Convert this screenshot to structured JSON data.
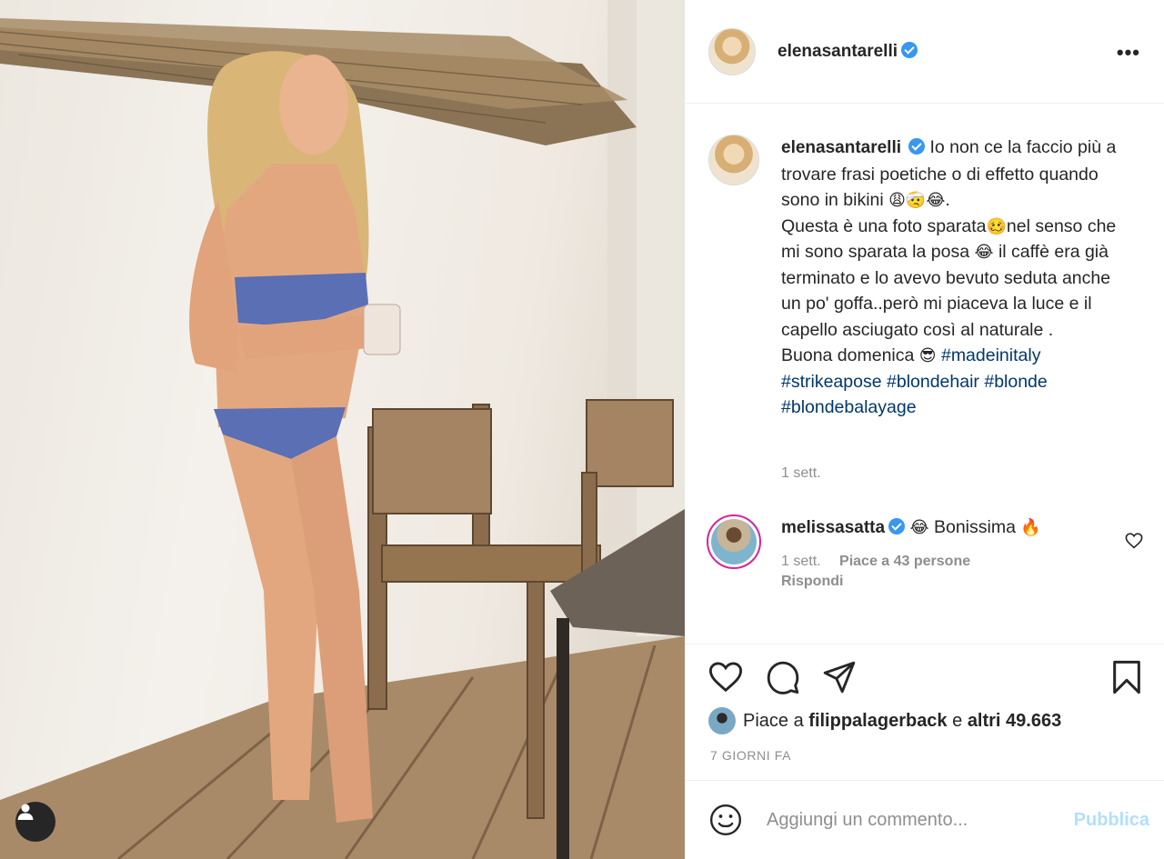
{
  "post": {
    "username": "elenasantarelli",
    "verified": true,
    "more_icon": "more-horizontal-icon",
    "caption": {
      "line1": "Io non ce la faccio più a trovare frasi poetiche o di effetto quando sono in bikini",
      "emojis1": "😩🤕😂",
      "line2": "Questa è una foto sparata",
      "emoji2": "🥴",
      "line3": "nel senso che mi sono sparata la posa",
      "emoji3": "😂",
      "line4": "il caffè era già terminato e lo avevo bevuto seduta anche un po' goffa..però mi piaceva la luce e il capello asciugato così al naturale .",
      "line5": "Buona domenica",
      "emoji5": "😎",
      "hashtags": [
        "#madeinitaly",
        "#strikeapose",
        "#blondehair",
        "#blonde",
        "#blondebalayage"
      ]
    },
    "caption_time": "1 sett."
  },
  "comment": {
    "username": "melissasatta",
    "verified": true,
    "emoji_before": "😂",
    "text": "Bonissima",
    "emoji_after": "🔥",
    "time": "1 sett.",
    "likes": "Piace a 43 persone",
    "reply": "Rispondi"
  },
  "actions": {
    "like_icon": "heart-icon",
    "comment_icon": "comment-icon",
    "share_icon": "send-icon",
    "save_icon": "bookmark-icon"
  },
  "likes": {
    "prefix": "Piace a",
    "user": "filippalagerback",
    "middle": "e",
    "others": "altri 49.663"
  },
  "posted_ago": "7 GIORNI FA",
  "add_comment": {
    "placeholder": "Aggiungi un commento...",
    "publish_label": "Pubblica"
  },
  "colors": {
    "link": "#00376b",
    "verified": "#3897f0",
    "publish_disabled": "#b2dffc",
    "muted": "#8e8e8e"
  }
}
